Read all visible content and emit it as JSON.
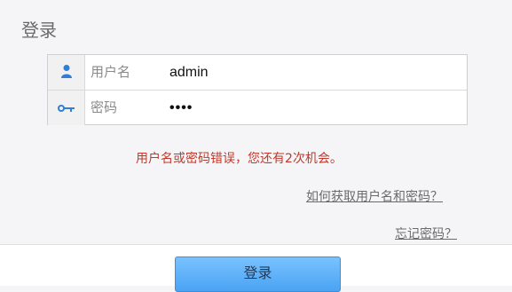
{
  "title": "登录",
  "form": {
    "username_label": "用户名",
    "username_value": "admin",
    "password_label": "密码",
    "password_value": "••••"
  },
  "error_message": "用户名或密码错误，您还有2次机会。",
  "links": {
    "help": "如何获取用户名和密码？",
    "forgot": "忘记密码？"
  },
  "button": {
    "login": "登录"
  },
  "colors": {
    "icon_blue": "#2f7fd6",
    "error_red": "#c0392b",
    "button_blue": "#4aa3f3"
  },
  "icons": {
    "user": "user-icon",
    "key": "key-icon"
  }
}
